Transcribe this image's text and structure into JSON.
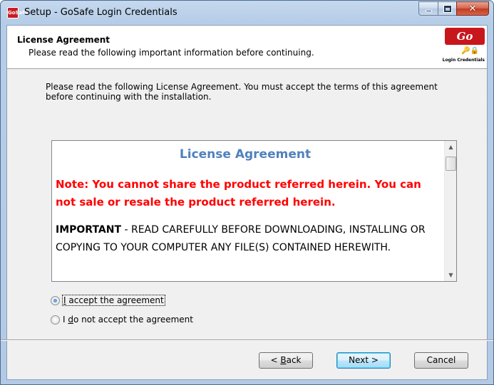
{
  "window": {
    "title": "Setup - GoSafe Login Credentials",
    "icon": "gosafe-app-icon"
  },
  "header": {
    "title": "License Agreement",
    "subtitle": "Please read the following important information before continuing.",
    "logo_text": "Go Safe",
    "logo_caption": "Login Credentials",
    "app_icon_text": "GoSafe"
  },
  "intro": {
    "text": "Please read the following License Agreement. You must accept the terms of this agreement before continuing with the installation."
  },
  "license": {
    "title": "License Agreement",
    "note": "Note: You cannot share the product referred herein. You can not sale or resale the product referred herein.",
    "important_label": "IMPORTANT",
    "important_text": " - READ CAREFULLY BEFORE DOWNLOADING, INSTALLING OR COPYING TO YOUR COMPUTER ANY FILE(S) CONTAINED HEREWITH."
  },
  "options": {
    "accept": {
      "prefix": "",
      "accel": "I",
      "rest": " accept the agreement",
      "selected": true
    },
    "decline": {
      "prefix": "I ",
      "accel": "d",
      "rest": "o not accept the agreement",
      "selected": false
    }
  },
  "buttons": {
    "back_prefix": "< ",
    "back_accel": "B",
    "back_rest": "ack",
    "next": "Next >",
    "cancel": "Cancel"
  },
  "colors": {
    "doc_title": "#4f81bd",
    "note": "#ff0000",
    "logo": "#c8161d"
  }
}
